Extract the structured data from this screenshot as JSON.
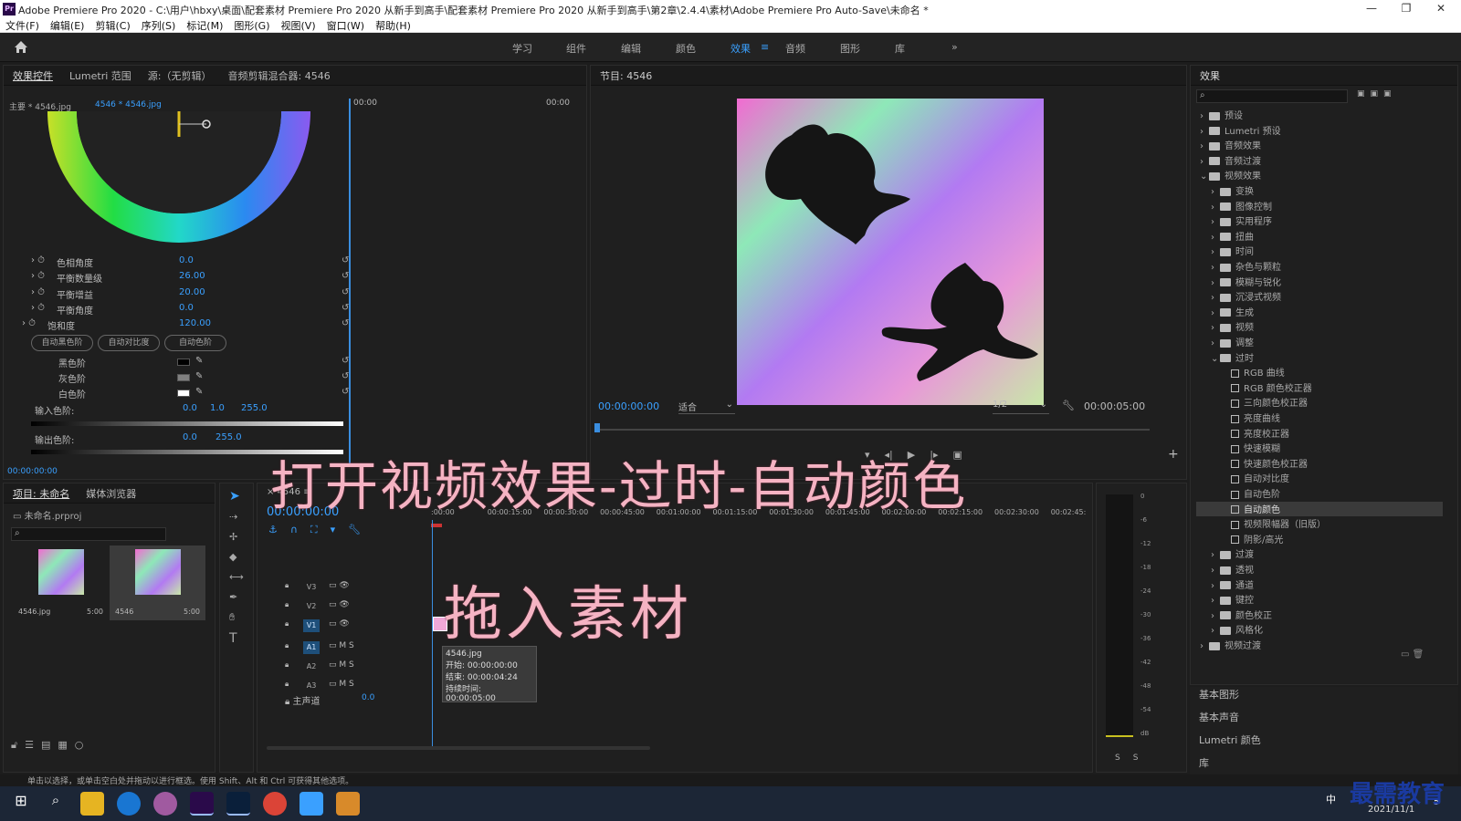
{
  "titlebar": {
    "app_icon": "Pr",
    "title": "Adobe Premiere Pro 2020 - C:\\用户\\hbxy\\桌面\\配套素材 Premiere Pro 2020 从新手到高手\\配套素材 Premiere Pro 2020 从新手到高手\\第2章\\2.4.4\\素材\\Adobe Premiere Pro Auto-Save\\未命名 *",
    "minimize": "—",
    "maximize": "❐",
    "close": "✕"
  },
  "menu": [
    "文件(F)",
    "编辑(E)",
    "剪辑(C)",
    "序列(S)",
    "标记(M)",
    "图形(G)",
    "视图(V)",
    "窗口(W)",
    "帮助(H)"
  ],
  "workspace": {
    "home_icon": "home-icon",
    "tabs": [
      "学习",
      "组件",
      "编辑",
      "颜色",
      "效果",
      "音频",
      "图形",
      "库"
    ],
    "active": "效果",
    "more": "»"
  },
  "effect_controls": {
    "tabs": [
      "效果控件",
      "Lumetri 范围",
      "源:（无剪辑）",
      "音频剪辑混合器: 4546"
    ],
    "source_label": "主要 * 4546.jpg",
    "clip_label": "4546 * 4546.jpg",
    "time_start": "00:00",
    "time_end": "00:00",
    "params": [
      {
        "name": "色相角度",
        "value": "0.0"
      },
      {
        "name": "平衡数量级",
        "value": "26.00"
      },
      {
        "name": "平衡增益",
        "value": "20.00"
      },
      {
        "name": "平衡角度",
        "value": "0.0"
      },
      {
        "name": "饱和度",
        "value": "120.00"
      }
    ],
    "buttons": [
      "自动黑色阶",
      "自动对比度",
      "自动色阶"
    ],
    "levels": [
      {
        "name": "黑色阶",
        "color": "#000000"
      },
      {
        "name": "灰色阶",
        "color": "#808080"
      },
      {
        "name": "白色阶",
        "color": "#ffffff"
      }
    ],
    "input_label": "输入色阶:",
    "input_vals": [
      "0.0",
      "1.0",
      "255.0"
    ],
    "output_label": "输出色阶:",
    "output_vals": [
      "0.0",
      "255.0"
    ],
    "timecode": "00:00:00:00"
  },
  "program": {
    "title": "节目: 4546",
    "timecode": "00:00:00:00",
    "fit": "适合",
    "quality": "1/2",
    "duration": "00:00:05:00"
  },
  "effects_panel": {
    "title": "效果",
    "items": [
      {
        "label": "预设",
        "type": "folder",
        "indent": 0
      },
      {
        "label": "Lumetri 预设",
        "type": "folder",
        "indent": 0
      },
      {
        "label": "音频效果",
        "type": "folder",
        "indent": 0
      },
      {
        "label": "音频过渡",
        "type": "folder",
        "indent": 0
      },
      {
        "label": "视频效果",
        "type": "folder",
        "indent": 0,
        "open": true
      },
      {
        "label": "变换",
        "type": "folder",
        "indent": 1
      },
      {
        "label": "图像控制",
        "type": "folder",
        "indent": 1
      },
      {
        "label": "实用程序",
        "type": "folder",
        "indent": 1
      },
      {
        "label": "扭曲",
        "type": "folder",
        "indent": 1
      },
      {
        "label": "时间",
        "type": "folder",
        "indent": 1
      },
      {
        "label": "杂色与颗粒",
        "type": "folder",
        "indent": 1
      },
      {
        "label": "模糊与锐化",
        "type": "folder",
        "indent": 1
      },
      {
        "label": "沉浸式视频",
        "type": "folder",
        "indent": 1
      },
      {
        "label": "生成",
        "type": "folder",
        "indent": 1
      },
      {
        "label": "视频",
        "type": "folder",
        "indent": 1
      },
      {
        "label": "调整",
        "type": "folder",
        "indent": 1
      },
      {
        "label": "过时",
        "type": "folder",
        "indent": 1,
        "open": true
      },
      {
        "label": "RGB 曲线",
        "type": "effect",
        "indent": 2
      },
      {
        "label": "RGB 颜色校正器",
        "type": "effect",
        "indent": 2
      },
      {
        "label": "三向颜色校正器",
        "type": "effect",
        "indent": 2
      },
      {
        "label": "亮度曲线",
        "type": "effect",
        "indent": 2
      },
      {
        "label": "亮度校正器",
        "type": "effect",
        "indent": 2
      },
      {
        "label": "快速模糊",
        "type": "effect",
        "indent": 2
      },
      {
        "label": "快速颜色校正器",
        "type": "effect",
        "indent": 2
      },
      {
        "label": "自动对比度",
        "type": "effect",
        "indent": 2
      },
      {
        "label": "自动色阶",
        "type": "effect",
        "indent": 2
      },
      {
        "label": "自动颜色",
        "type": "effect",
        "indent": 2,
        "selected": true
      },
      {
        "label": "视频限幅器（旧版）",
        "type": "effect",
        "indent": 2
      },
      {
        "label": "阴影/高光",
        "type": "effect",
        "indent": 2
      },
      {
        "label": "过渡",
        "type": "folder",
        "indent": 1
      },
      {
        "label": "透视",
        "type": "folder",
        "indent": 1
      },
      {
        "label": "通道",
        "type": "folder",
        "indent": 1
      },
      {
        "label": "键控",
        "type": "folder",
        "indent": 1
      },
      {
        "label": "颜色校正",
        "type": "folder",
        "indent": 1
      },
      {
        "label": "风格化",
        "type": "folder",
        "indent": 1
      },
      {
        "label": "视频过渡",
        "type": "folder",
        "indent": 0
      }
    ],
    "bottom": [
      "基本图形",
      "基本声音",
      "Lumetri 颜色",
      "库"
    ]
  },
  "project": {
    "tabs": [
      "项目: 未命名",
      "媒体浏览器"
    ],
    "file": "未命名.prproj",
    "items": [
      {
        "name": "4546.jpg",
        "dur": "5:00"
      },
      {
        "name": "4546",
        "dur": "5:00"
      }
    ]
  },
  "timeline": {
    "tab": "4546",
    "timecode": "00:00:00:00",
    "ruler": [
      ":00:00",
      "00:00:15:00",
      "00:00:30:00",
      "00:00:45:00",
      "00:01:00:00",
      "00:01:15:00",
      "00:01:30:00",
      "00:01:45:00",
      "00:02:00:00",
      "00:02:15:00",
      "00:02:30:00",
      "00:02:45:"
    ],
    "tracks": [
      "V3",
      "V2",
      "V1",
      "A1",
      "A2",
      "A3"
    ],
    "master": "主声道",
    "master_val": "0.0",
    "tooltip": [
      "4546.jpg",
      "开始: 00:00:00:00",
      "结束: 00:00:04:24",
      "持续时间: 00:00:05:00"
    ]
  },
  "meter": {
    "labels": [
      "0",
      "-6",
      "-12",
      "-18",
      "-24",
      "-30",
      "-36",
      "-42",
      "-48",
      "-54",
      "dB"
    ],
    "solo": [
      "S",
      "S"
    ]
  },
  "status": "单击以选择，或单击空白处并拖动以进行框选。使用 Shift、Alt 和 Ctrl 可获得其他选项。",
  "overlay": {
    "line1": "打开视频效果-过时-自动颜色",
    "line2": "拖入素材"
  },
  "watermark": "最需教育",
  "taskbar": {
    "date": "2021/11/1",
    "ime": "中",
    "notify": "5"
  }
}
